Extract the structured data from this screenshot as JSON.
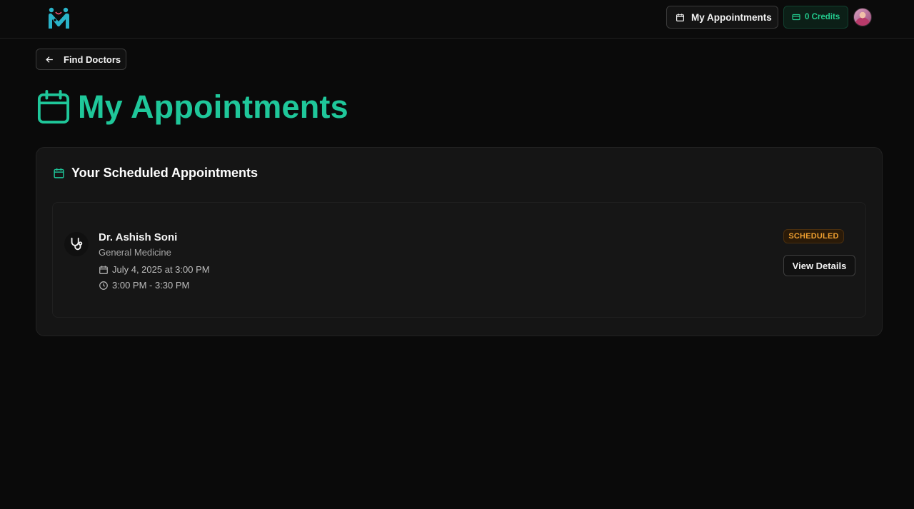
{
  "header": {
    "logo_icon": "medical-m-logo",
    "nav_appointments_label": "My Appointments",
    "credits_label": "0 Credits",
    "accent_color": "#1fc79a"
  },
  "back_button": {
    "label": "Find Doctors",
    "icon": "arrow-left-icon"
  },
  "page": {
    "title": "My Appointments",
    "title_icon": "calendar-icon"
  },
  "card": {
    "title": "Your Scheduled Appointments",
    "appointments": [
      {
        "doctor_name": "Dr. Ashish Soni",
        "specialty": "General Medicine",
        "date_text": "July 4, 2025 at 3:00 PM",
        "time_range": "3:00 PM - 3:30 PM",
        "status": "SCHEDULED",
        "status_color": "#f0a030",
        "action_label": "View Details"
      }
    ]
  }
}
